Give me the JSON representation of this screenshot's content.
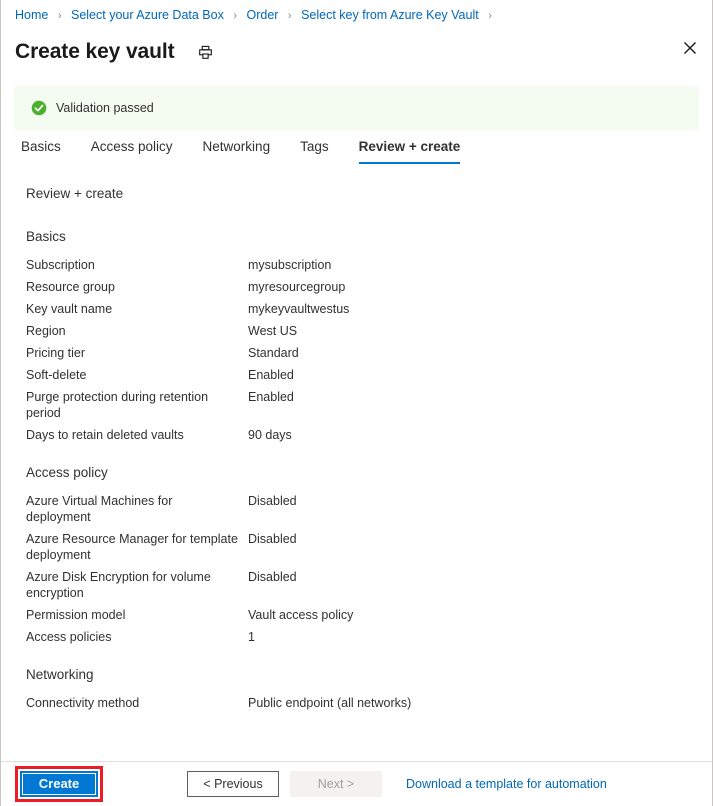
{
  "breadcrumb": {
    "separator": "›",
    "items": [
      {
        "label": "Home"
      },
      {
        "label": "Select your Azure Data Box"
      },
      {
        "label": "Order"
      },
      {
        "label": "Select key from Azure Key Vault"
      }
    ]
  },
  "header": {
    "title": "Create key vault",
    "print_icon": "printer-icon",
    "close_icon": "close-icon"
  },
  "banner": {
    "icon": "success-check-icon",
    "text": "Validation passed",
    "background": "#f4fbf0",
    "icon_color": "#4caf2d"
  },
  "tabs": [
    {
      "label": "Basics",
      "active": false
    },
    {
      "label": "Access policy",
      "active": false
    },
    {
      "label": "Networking",
      "active": false
    },
    {
      "label": "Tags",
      "active": false
    },
    {
      "label": "Review + create",
      "active": true
    }
  ],
  "content": {
    "heading": "Review + create",
    "sections": [
      {
        "title": "Basics",
        "rows": [
          {
            "label": "Subscription",
            "value": "mysubscription"
          },
          {
            "label": "Resource group",
            "value": "myresourcegroup"
          },
          {
            "label": "Key vault name",
            "value": "mykeyvaultwestus"
          },
          {
            "label": "Region",
            "value": "West US"
          },
          {
            "label": "Pricing tier",
            "value": "Standard"
          },
          {
            "label": "Soft-delete",
            "value": "Enabled"
          },
          {
            "label": "Purge protection during retention period",
            "value": "Enabled"
          },
          {
            "label": "Days to retain deleted vaults",
            "value": "90 days"
          }
        ]
      },
      {
        "title": "Access policy",
        "rows": [
          {
            "label": "Azure Virtual Machines for deployment",
            "value": "Disabled"
          },
          {
            "label": "Azure Resource Manager for template deployment",
            "value": "Disabled"
          },
          {
            "label": "Azure Disk Encryption for volume encryption",
            "value": "Disabled"
          },
          {
            "label": "Permission model",
            "value": "Vault access policy"
          },
          {
            "label": "Access policies",
            "value": "1"
          }
        ]
      },
      {
        "title": "Networking",
        "rows": [
          {
            "label": "Connectivity method",
            "value": "Public endpoint (all networks)"
          }
        ]
      }
    ]
  },
  "footer": {
    "create_label": "Create",
    "previous_label": "< Previous",
    "next_label": "Next >",
    "download_label": "Download a template for automation",
    "highlight_color": "#ec1c24",
    "create_color": "#0078d4"
  }
}
